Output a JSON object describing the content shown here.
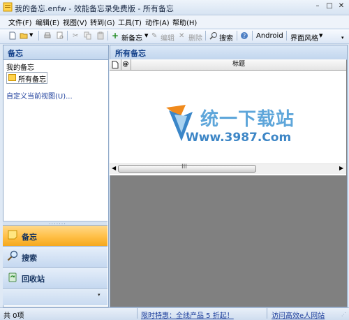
{
  "window": {
    "title": "我的备忘.enfw - 效能备忘录免费版 - 所有备忘",
    "minimize": "–",
    "maximize": "□",
    "close": "✕"
  },
  "menu": [
    "文件(F)",
    "编辑(E)",
    "视图(V)",
    "转到(G)",
    "工具(T)",
    "动作(A)",
    "帮助(H)"
  ],
  "toolbar": {
    "new_note": "新备忘",
    "edit": "编辑",
    "delete": "删除",
    "search": "搜索",
    "android": "Android",
    "skin": "界面风格"
  },
  "left": {
    "header": "备忘",
    "group": "我的备忘",
    "all_notes": "所有备忘",
    "customize": "自定义当前视图(U)...",
    "nav": {
      "notes": "备忘",
      "search": "搜索",
      "recycle": "回收站"
    }
  },
  "right": {
    "header": "所有备忘",
    "columns": {
      "attach": "@",
      "title": "标题"
    },
    "scroll_grip": "III"
  },
  "watermark": {
    "cn": "统一下载站",
    "url": "Www.3987.Com"
  },
  "status": {
    "count": "共 0项",
    "promo": "限时特惠：全线产品 5 折起！",
    "site": "访问高效e人网站"
  },
  "colors": {
    "accent": "#15428b",
    "active_nav": "#ffbf46",
    "link": "#1e3f9c"
  }
}
